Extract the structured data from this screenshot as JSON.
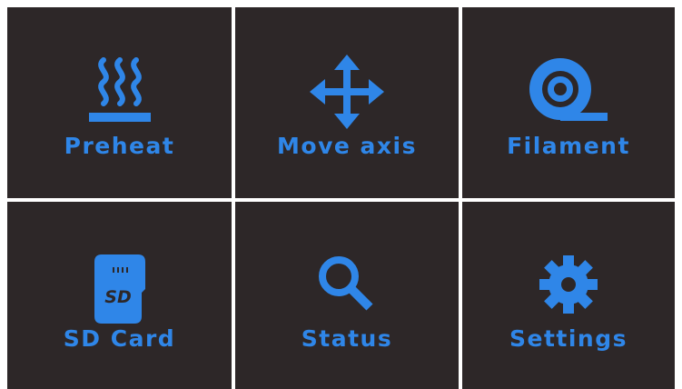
{
  "colors": {
    "tile_background": "#2d2728",
    "accent": "#2f86e8",
    "separator": "#ffffff"
  },
  "menu": {
    "tiles": [
      {
        "label": "Preheat",
        "icon": "preheat-icon"
      },
      {
        "label": "Move axis",
        "icon": "move-axis-icon"
      },
      {
        "label": "Filament",
        "icon": "filament-icon"
      },
      {
        "label": "SD Card",
        "icon": "sd-card-icon"
      },
      {
        "label": "Status",
        "icon": "search-icon"
      },
      {
        "label": "Settings",
        "icon": "gear-icon"
      }
    ]
  }
}
